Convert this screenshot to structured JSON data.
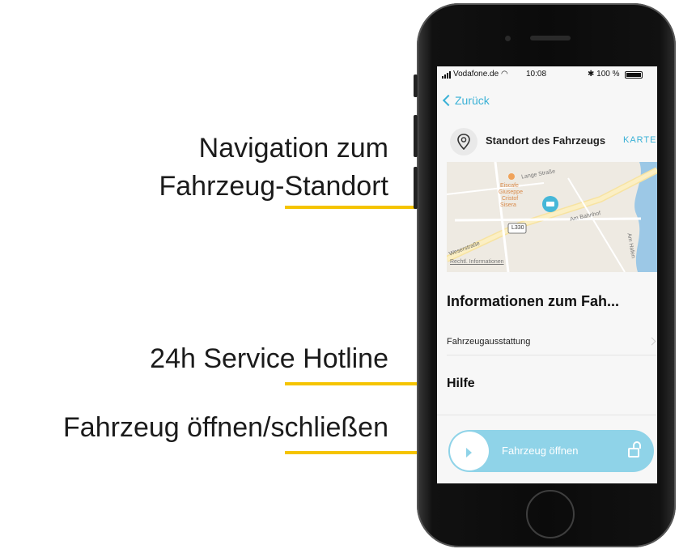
{
  "annotations": {
    "nav_line1": "Navigation zum",
    "nav_line2": "Fahrzeug-Standort",
    "hotline": "24h Service Hotline",
    "open_close": "Fahrzeug öffnen/schließen",
    "accent_color": "#f5c400"
  },
  "status_bar": {
    "carrier": "Vodafone.de",
    "time": "10:08",
    "battery": "100 %"
  },
  "nav": {
    "back_label": "Zurück"
  },
  "location": {
    "title": "Standort des Fahrzeugs",
    "map_link": "KARTE",
    "icon": "location-pin-icon"
  },
  "map": {
    "labels": [
      "Lange Straße",
      "Eiscafe",
      "Giuseppe",
      "Cristof",
      "Sisera",
      "L330",
      "Am Bahnhof",
      "Weserstraße",
      "Rechtl. Informationen",
      "Am Hafen"
    ]
  },
  "sections": {
    "info_title": "Informationen zum Fah...",
    "equipment_label": "Fahrzeugausstattung",
    "help_title": "Hilfe"
  },
  "slider": {
    "label": "Fahrzeug öffnen",
    "accent_color": "#8fd3e8"
  }
}
